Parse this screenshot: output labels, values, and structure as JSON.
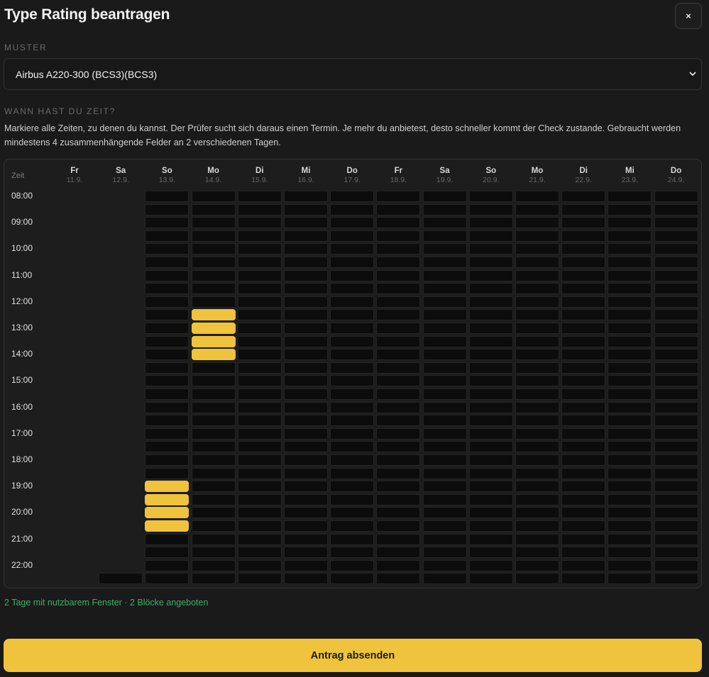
{
  "dialog": {
    "title": "Type Rating beantragen",
    "close_label": "×"
  },
  "muster": {
    "label": "MUSTER",
    "selected": "Airbus A220-300 (BCS3)(BCS3)"
  },
  "availability": {
    "label": "WANN HAST DU ZEIT?",
    "description": "Markiere alle Zeiten, zu denen du kannst. Der Prüfer sucht sich daraus einen Termin. Je mehr du anbietest, desto schneller kommt der Check zustande. Gebraucht werden mindestens 4 zusammenhängende Felder an 2 verschiedenen Tagen.",
    "zeit_header": "Zeit",
    "days": [
      {
        "name": "Fr",
        "date": "11.9."
      },
      {
        "name": "Sa",
        "date": "12.9."
      },
      {
        "name": "So",
        "date": "13.9."
      },
      {
        "name": "Mo",
        "date": "14.9."
      },
      {
        "name": "Di",
        "date": "15.9."
      },
      {
        "name": "Mi",
        "date": "16.9."
      },
      {
        "name": "Do",
        "date": "17.9."
      },
      {
        "name": "Fr",
        "date": "18.9."
      },
      {
        "name": "Sa",
        "date": "19.9."
      },
      {
        "name": "So",
        "date": "20.9."
      },
      {
        "name": "Mo",
        "date": "21.9."
      },
      {
        "name": "Di",
        "date": "22.9."
      },
      {
        "name": "Mi",
        "date": "23.9."
      },
      {
        "name": "Do",
        "date": "24.9."
      }
    ],
    "times": [
      "08:00",
      "09:00",
      "10:00",
      "11:00",
      "12:00",
      "13:00",
      "14:00",
      "15:00",
      "16:00",
      "17:00",
      "18:00",
      "19:00",
      "20:00",
      "21:00",
      "22:00"
    ],
    "selected_slots": [
      {
        "day": "Mo 14.9.",
        "slots": [
          "12:30",
          "13:00",
          "13:30",
          "14:00"
        ]
      },
      {
        "day": "So 13.9.",
        "slots": [
          "19:00",
          "19:30",
          "20:00",
          "20:30"
        ]
      }
    ],
    "summary": "2 Tage mit nutzbarem Fenster · 2 Blöcke angeboten"
  },
  "submit": {
    "label": "Antrag absenden"
  },
  "colors": {
    "accent": "#f0c33c",
    "summary_green": "#3fae6a",
    "background": "#1a1a1a"
  }
}
